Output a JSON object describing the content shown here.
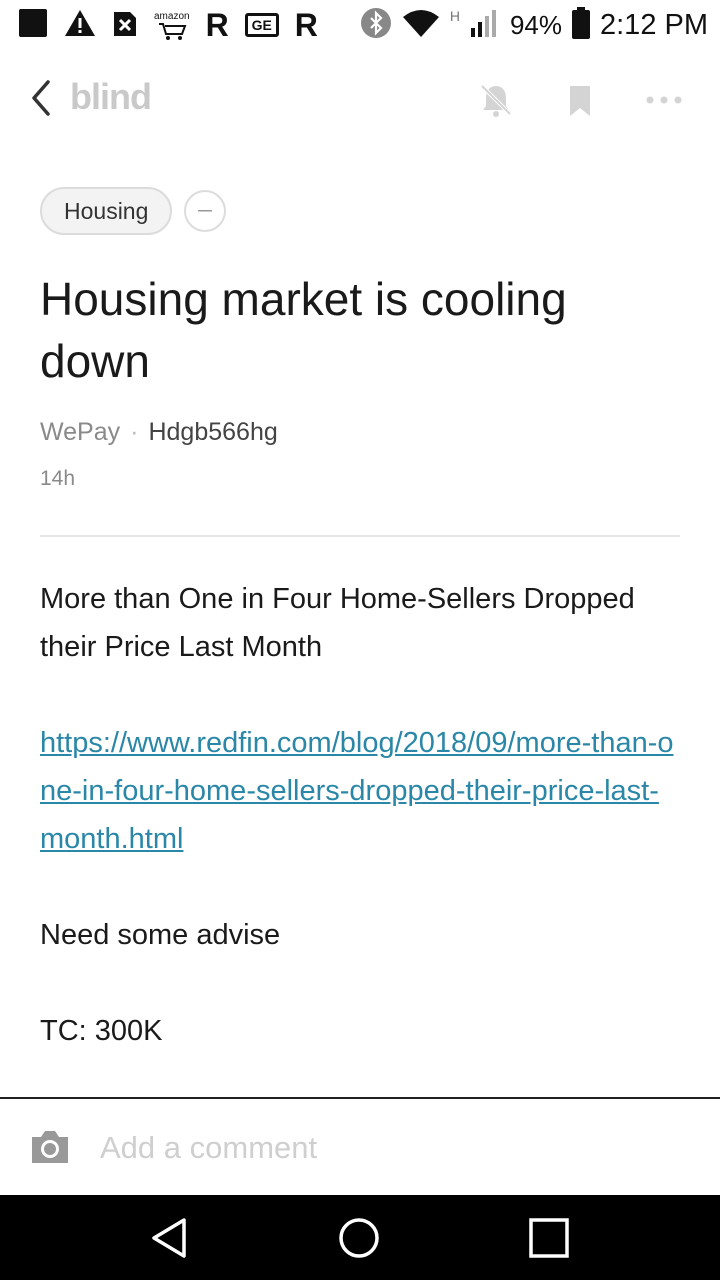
{
  "status_bar": {
    "notif_r1": "R",
    "notif_r2": "R",
    "amazon_label": "amazon",
    "ge_label": "GE",
    "network_label": "H",
    "battery_percent": "94%",
    "time": "2:12 PM"
  },
  "app_bar": {
    "brand": "blind"
  },
  "post": {
    "tag": "Housing",
    "title": "Housing market is cooling down",
    "company": "WePay",
    "separator": "·",
    "author": "Hdgb566hg",
    "age": "14h",
    "body": {
      "line1": "More than One in Four Home-Sellers Dropped their Price Last Month",
      "link": "https://www.redfin.com/blog/2018/09/more-than-one-in-four-home-sellers-dropped-their-price-last-month.html",
      "line2": "Need some advise",
      "line3": "TC: 300K"
    }
  },
  "comment_bar": {
    "placeholder": "Add a comment"
  },
  "colors": {
    "link": "#2a87a8",
    "brand_gray": "#c9c9c9",
    "nav_bar": "#000000"
  }
}
